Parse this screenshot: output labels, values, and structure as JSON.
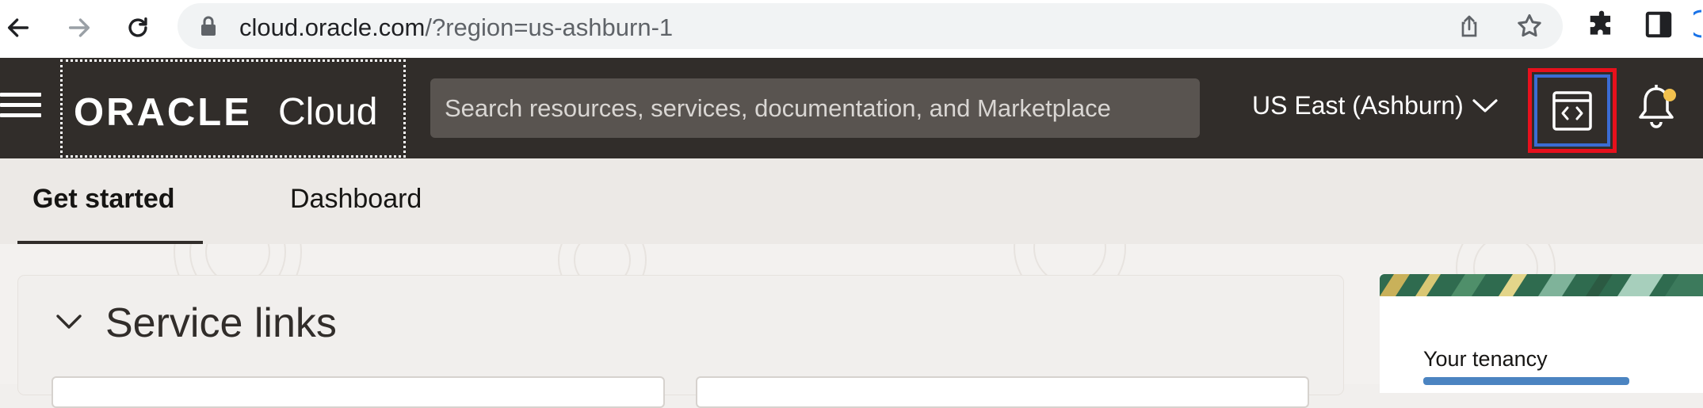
{
  "browser": {
    "url_host": "cloud.oracle.com",
    "url_path": "/?region=us-ashburn-1",
    "icons": [
      "back-arrow-icon",
      "forward-arrow-icon",
      "reload-icon",
      "lock-icon",
      "share-icon",
      "star-icon",
      "puzzle-icon",
      "sidepanel-icon"
    ]
  },
  "header": {
    "logo_oracle": "ORACLE",
    "logo_cloud": "Cloud",
    "search_placeholder": "Search resources, services, documentation, and Marketplace",
    "region_label": "US East (Ashburn)",
    "colors": {
      "background": "#312d2a",
      "search": "#595450",
      "highlight_red": "#e8101c",
      "highlight_blue": "#3b6cd4",
      "notification_dot": "#f2c14e"
    }
  },
  "tabs": [
    {
      "label": "Get started",
      "active": true
    },
    {
      "label": "Dashboard",
      "active": false
    }
  ],
  "main": {
    "service_links_title": "Service links",
    "tenancy_label": "Your tenancy"
  }
}
